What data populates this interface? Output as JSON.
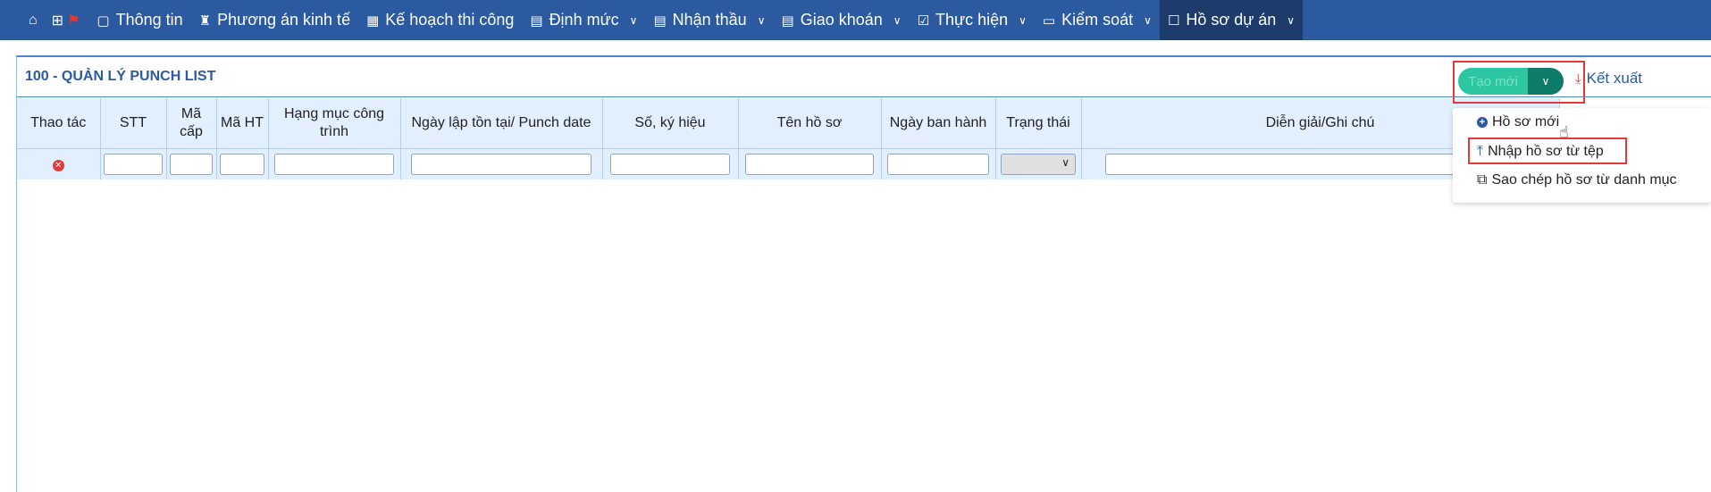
{
  "nav": {
    "items": [
      {
        "label": "Thông tin",
        "icon": "window-icon",
        "dropdown": false
      },
      {
        "label": "Phương án kinh tế",
        "icon": "bag-icon",
        "dropdown": false
      },
      {
        "label": "Kế hoạch thi công",
        "icon": "calendar-icon",
        "dropdown": false
      },
      {
        "label": "Định mức",
        "icon": "document-icon",
        "dropdown": true
      },
      {
        "label": "Nhận thầu",
        "icon": "document-icon",
        "dropdown": true
      },
      {
        "label": "Giao khoán",
        "icon": "document-icon",
        "dropdown": true
      },
      {
        "label": "Thực hiện",
        "icon": "checklist-icon",
        "dropdown": true
      },
      {
        "label": "Kiểm soát",
        "icon": "monitor-icon",
        "dropdown": true
      },
      {
        "label": "Hồ sơ dự án",
        "icon": "clipboard-icon",
        "dropdown": true,
        "active": true
      }
    ]
  },
  "panel": {
    "title": "100 - QUẢN LÝ PUNCH LIST"
  },
  "table": {
    "headers": [
      "Thao tác",
      "STT",
      "Mã cấp",
      "Mã HT",
      "Hạng mục công trình",
      "Ngày lập tồn tại/ Punch date",
      "Số, ký hiệu",
      "Tên hồ sơ",
      "Ngày ban hành",
      "Trạng thái",
      "Diễn giải/Ghi chú"
    ]
  },
  "actions": {
    "create_label": "Tạo mới",
    "export_label": "Kết xuất"
  },
  "menu": {
    "items": [
      {
        "label": "Hồ sơ mới",
        "icon": "plus-circle-icon"
      },
      {
        "label": "Nhập hồ sơ từ tệp",
        "icon": "upload-icon"
      },
      {
        "label": "Sao chép hồ sơ từ danh mục",
        "icon": "copy-icon"
      }
    ]
  },
  "colors": {
    "nav_bg": "#2c5aa0",
    "nav_active": "#1d3c6b",
    "header_bg": "#e2efff",
    "highlight_red": "#e53935",
    "create_btn": "#2cc7a0",
    "dropdown_btn": "#0e7b69"
  }
}
